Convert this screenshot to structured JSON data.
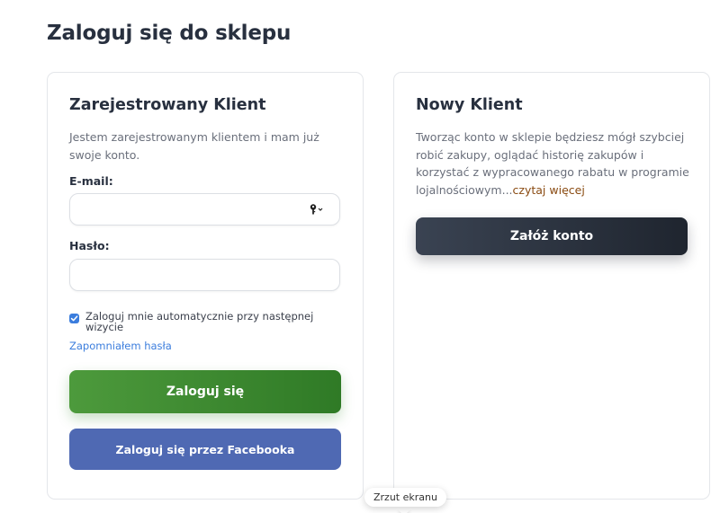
{
  "page": {
    "title": "Zaloguj się do sklepu"
  },
  "registered": {
    "title": "Zarejestrowany Klient",
    "description": "Jestem zarejestrowanym klientem i mam już swoje konto.",
    "email_label": "E-mail:",
    "email_value": "",
    "password_label": "Hasło:",
    "password_value": "",
    "remember_label": "Zaloguj mnie automatycznie przy następnej wizycie",
    "remember_checked": true,
    "forgot_link": "Zapomniałem hasła",
    "login_button": "Zaloguj się",
    "facebook_button": "Zaloguj się przez Facebooka"
  },
  "new_customer": {
    "title": "Nowy Klient",
    "description": "Tworząc konto w sklepie będziesz mógł szybciej robić zakupy, oglądać historię zakupów i korzystać z wypracowanego rabatu w programie lojalnościowym...",
    "read_more_link": "czytaj więcej",
    "register_button": "Załóż konto"
  },
  "tooltip": {
    "text": "Zrzut ekranu"
  },
  "colors": {
    "login_button": "#3d8a30",
    "facebook_button": "#4f69b3",
    "register_button": "#2a313c",
    "link": "#3b7ddd",
    "read_more": "#8a4b12",
    "checkbox": "#3b7ddd"
  },
  "icons": {
    "password_manager": "key-icon",
    "checkbox": "checkmark-icon"
  }
}
